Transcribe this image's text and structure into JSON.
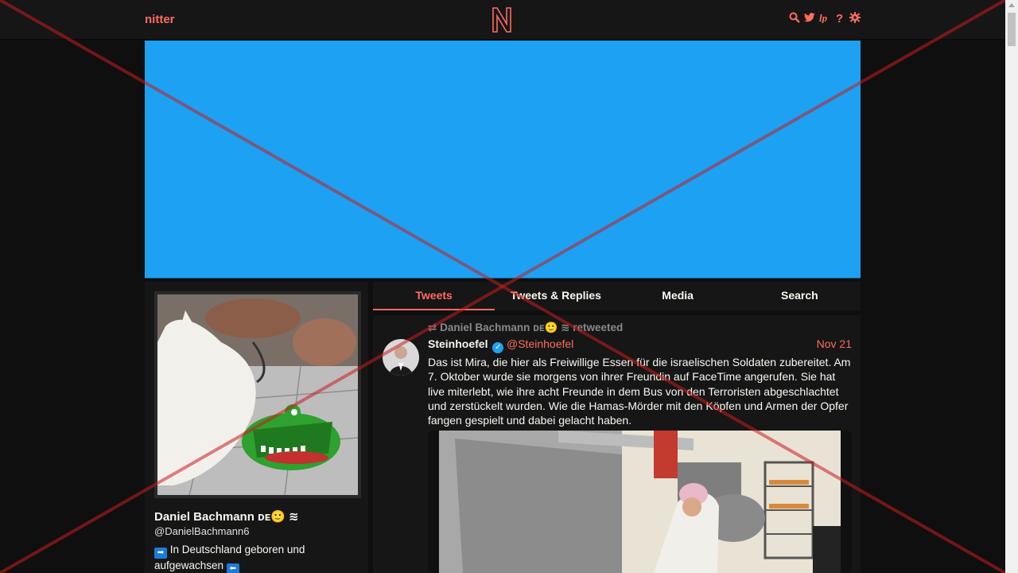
{
  "nav": {
    "brand": "nitter",
    "icons": [
      "search-icon",
      "twitter-icon",
      "rss-icon",
      "help-icon",
      "gear-icon"
    ]
  },
  "colors": {
    "accent": "#ff6c60",
    "banner": "#1da1f2",
    "background": "#0f0f0f",
    "card": "#161616"
  },
  "profile": {
    "name": "Daniel Bachmann ᴅᴇ🙂 ≋",
    "handle": "@DanielBachmann6",
    "bio_flag_left": "➡",
    "bio_text": "In Deutschland geboren und aufgewachsen",
    "bio_flag_right": "⬅"
  },
  "tabs": [
    "Tweets",
    "Tweets & Replies",
    "Media",
    "Search"
  ],
  "tweet": {
    "retweet_label": "Daniel Bachmann ᴅᴇ🙂 ≋  retweeted",
    "fullname": "Steinhoefel",
    "username": "@Steinhoefel",
    "date": "Nov 21",
    "content": "Das ist Mira, die hier als Freiwillige Essen für die israelischen Soldaten zubereitet. Am 7. Oktober wurde sie morgens von ihrer Freundin auf FaceTime angerufen. Sie hat live miterlebt, wie ihre acht Freunde in dem Bus von den Terroristen abgeschlachtet und zerstückelt wurden. Wie die Hamas-Mörder mit den Köpfen und Armen der Opfer fangen gespielt und dabei gelacht haben."
  }
}
